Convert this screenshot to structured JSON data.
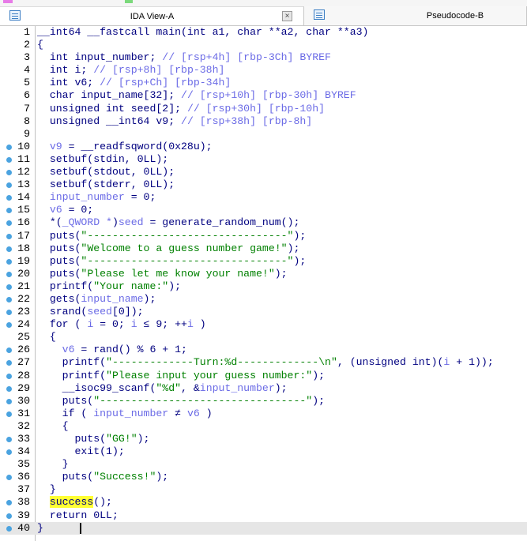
{
  "tabs": [
    {
      "label": "IDA View-A",
      "active": true,
      "close_glyph": "×"
    },
    {
      "label": "Pseudocode-B",
      "active": false
    }
  ],
  "code_lines": [
    {
      "n": "1",
      "dot": false,
      "tokens": [
        [
          "k",
          "__int64 __fastcall main(int a1, char **a2, char **a3)"
        ]
      ]
    },
    {
      "n": "2",
      "dot": false,
      "tokens": [
        [
          "k",
          "{"
        ]
      ]
    },
    {
      "n": "3",
      "dot": false,
      "tokens": [
        [
          "k",
          "  int input_number; "
        ],
        [
          "c",
          "// [rsp+4h] [rbp-3Ch] BYREF"
        ]
      ]
    },
    {
      "n": "4",
      "dot": false,
      "tokens": [
        [
          "k",
          "  int i; "
        ],
        [
          "c",
          "// [rsp+8h] [rbp-38h]"
        ]
      ]
    },
    {
      "n": "5",
      "dot": false,
      "tokens": [
        [
          "k",
          "  int v6; "
        ],
        [
          "c",
          "// [rsp+Ch] [rbp-34h]"
        ]
      ]
    },
    {
      "n": "6",
      "dot": false,
      "tokens": [
        [
          "k",
          "  char input_name[32]; "
        ],
        [
          "c",
          "// [rsp+10h] [rbp-30h] BYREF"
        ]
      ]
    },
    {
      "n": "7",
      "dot": false,
      "tokens": [
        [
          "k",
          "  unsigned int seed[2]; "
        ],
        [
          "c",
          "// [rsp+30h] [rbp-10h]"
        ]
      ]
    },
    {
      "n": "8",
      "dot": false,
      "tokens": [
        [
          "k",
          "  unsigned __int64 v9; "
        ],
        [
          "c",
          "// [rsp+38h] [rbp-8h]"
        ]
      ]
    },
    {
      "n": "9",
      "dot": false,
      "tokens": []
    },
    {
      "n": "10",
      "dot": true,
      "tokens": [
        [
          "v",
          "  v9"
        ],
        [
          "k",
          " = __readfsqword(0x28u);"
        ]
      ]
    },
    {
      "n": "11",
      "dot": true,
      "tokens": [
        [
          "k",
          "  setbuf(stdin, 0LL);"
        ]
      ]
    },
    {
      "n": "12",
      "dot": true,
      "tokens": [
        [
          "k",
          "  setbuf(stdout, 0LL);"
        ]
      ]
    },
    {
      "n": "13",
      "dot": true,
      "tokens": [
        [
          "k",
          "  setbuf(stderr, 0LL);"
        ]
      ]
    },
    {
      "n": "14",
      "dot": true,
      "tokens": [
        [
          "v",
          "  input_number"
        ],
        [
          "k",
          " = 0;"
        ]
      ]
    },
    {
      "n": "15",
      "dot": true,
      "tokens": [
        [
          "v",
          "  v6"
        ],
        [
          "k",
          " = 0;"
        ]
      ]
    },
    {
      "n": "16",
      "dot": true,
      "tokens": [
        [
          "k",
          "  *("
        ],
        [
          "v",
          "_QWORD *"
        ],
        [
          "k",
          ")"
        ],
        [
          "v",
          "seed"
        ],
        [
          "k",
          " = generate_random_num();"
        ]
      ]
    },
    {
      "n": "17",
      "dot": true,
      "tokens": [
        [
          "k",
          "  puts("
        ],
        [
          "s",
          "\"--------------------------------\""
        ],
        [
          "k",
          ");"
        ]
      ]
    },
    {
      "n": "18",
      "dot": true,
      "tokens": [
        [
          "k",
          "  puts("
        ],
        [
          "s",
          "\"Welcome to a guess number game!\""
        ],
        [
          "k",
          ");"
        ]
      ]
    },
    {
      "n": "19",
      "dot": true,
      "tokens": [
        [
          "k",
          "  puts("
        ],
        [
          "s",
          "\"--------------------------------\""
        ],
        [
          "k",
          ");"
        ]
      ]
    },
    {
      "n": "20",
      "dot": true,
      "tokens": [
        [
          "k",
          "  puts("
        ],
        [
          "s",
          "\"Please let me know your name!\""
        ],
        [
          "k",
          ");"
        ]
      ]
    },
    {
      "n": "21",
      "dot": true,
      "tokens": [
        [
          "k",
          "  printf("
        ],
        [
          "s",
          "\"Your name:\""
        ],
        [
          "k",
          ");"
        ]
      ]
    },
    {
      "n": "22",
      "dot": true,
      "tokens": [
        [
          "k",
          "  gets("
        ],
        [
          "v",
          "input_name"
        ],
        [
          "k",
          ");"
        ]
      ]
    },
    {
      "n": "23",
      "dot": true,
      "tokens": [
        [
          "k",
          "  srand("
        ],
        [
          "v",
          "seed"
        ],
        [
          "k",
          "[0]);"
        ]
      ]
    },
    {
      "n": "24",
      "dot": true,
      "tokens": [
        [
          "k",
          "  for ( "
        ],
        [
          "v",
          "i"
        ],
        [
          "k",
          " = 0; "
        ],
        [
          "v",
          "i"
        ],
        [
          "k",
          " ≤ 9; ++"
        ],
        [
          "v",
          "i"
        ],
        [
          "k",
          " )"
        ]
      ]
    },
    {
      "n": "25",
      "dot": false,
      "tokens": [
        [
          "k",
          "  {"
        ]
      ]
    },
    {
      "n": "26",
      "dot": true,
      "tokens": [
        [
          "v",
          "    v6"
        ],
        [
          "k",
          " = rand() % 6 + 1;"
        ]
      ]
    },
    {
      "n": "27",
      "dot": true,
      "tokens": [
        [
          "k",
          "    printf("
        ],
        [
          "s",
          "\"-------------Turn:%d-------------\\n\""
        ],
        [
          "k",
          ", (unsigned int)("
        ],
        [
          "v",
          "i"
        ],
        [
          "k",
          " + 1));"
        ]
      ]
    },
    {
      "n": "28",
      "dot": true,
      "tokens": [
        [
          "k",
          "    printf("
        ],
        [
          "s",
          "\"Please input your guess number:\""
        ],
        [
          "k",
          ");"
        ]
      ]
    },
    {
      "n": "29",
      "dot": true,
      "tokens": [
        [
          "k",
          "    __isoc99_scanf("
        ],
        [
          "s",
          "\"%d\""
        ],
        [
          "k",
          ", &"
        ],
        [
          "v",
          "input_number"
        ],
        [
          "k",
          ");"
        ]
      ]
    },
    {
      "n": "30",
      "dot": true,
      "tokens": [
        [
          "k",
          "    puts("
        ],
        [
          "s",
          "\"---------------------------------\""
        ],
        [
          "k",
          ");"
        ]
      ]
    },
    {
      "n": "31",
      "dot": true,
      "tokens": [
        [
          "k",
          "    if ( "
        ],
        [
          "v",
          "input_number"
        ],
        [
          "k",
          " ≠ "
        ],
        [
          "v",
          "v6"
        ],
        [
          "k",
          " )"
        ]
      ]
    },
    {
      "n": "32",
      "dot": false,
      "tokens": [
        [
          "k",
          "    {"
        ]
      ]
    },
    {
      "n": "33",
      "dot": true,
      "tokens": [
        [
          "k",
          "      puts("
        ],
        [
          "s",
          "\"GG!\""
        ],
        [
          "k",
          ");"
        ]
      ]
    },
    {
      "n": "34",
      "dot": true,
      "tokens": [
        [
          "k",
          "      exit(1);"
        ]
      ]
    },
    {
      "n": "35",
      "dot": false,
      "tokens": [
        [
          "k",
          "    }"
        ]
      ]
    },
    {
      "n": "36",
      "dot": true,
      "tokens": [
        [
          "k",
          "    puts("
        ],
        [
          "s",
          "\"Success!\""
        ],
        [
          "k",
          ");"
        ]
      ]
    },
    {
      "n": "37",
      "dot": false,
      "tokens": [
        [
          "k",
          "  }"
        ]
      ]
    },
    {
      "n": "38",
      "dot": true,
      "tokens": [
        [
          "k",
          "  "
        ],
        [
          "h",
          "success"
        ],
        [
          "k",
          "();"
        ]
      ]
    },
    {
      "n": "39",
      "dot": true,
      "tokens": [
        [
          "k",
          "  return 0LL;"
        ]
      ]
    },
    {
      "n": "40",
      "dot": true,
      "cur": true,
      "tokens": [
        [
          "k",
          "}"
        ]
      ]
    }
  ],
  "colors": {
    "keyword": "#000080",
    "comment": "#6b6be6",
    "string": "#008000",
    "highlight": "#ffff33",
    "breakpoint_dot": "#4aa3e0"
  },
  "icons": {
    "tab_icon": "pseudocode-window-icon",
    "close_icon": "close-icon"
  }
}
